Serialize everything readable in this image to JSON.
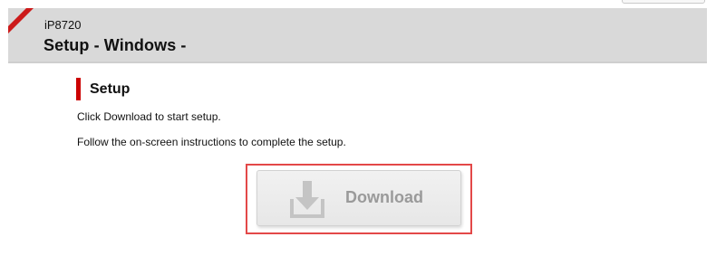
{
  "header": {
    "model": "iP8720",
    "title": "Setup - Windows -"
  },
  "setup": {
    "heading": "Setup",
    "instructions": [
      "Click Download to start setup.",
      "Follow the on-screen instructions to complete the setup."
    ],
    "download_label": "Download"
  },
  "icons": {
    "download": "download-arrow-tray-icon",
    "corner": "red-corner-ribbon"
  },
  "colors": {
    "accent_red": "#cc0000",
    "highlight_red": "#e34848",
    "header_gray": "#d9d9d9",
    "button_text_gray": "#9a9a9a"
  }
}
